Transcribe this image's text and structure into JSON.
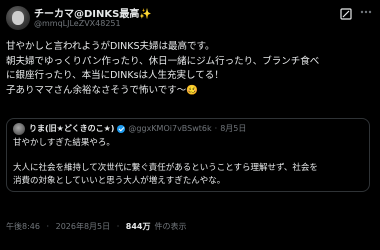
{
  "author": {
    "display_name": "チーカマ@DINKS最高✨",
    "handle": "@mmqLJLeZVX48251"
  },
  "tweet": {
    "lines": [
      "甘やかしと言われようがDINKS夫婦は最高です。",
      "朝夫婦でゆっくりパン作ったり、休日一緒にジム行ったり、ブランチ食べ",
      "に銀座行ったり、本当にDINKsは人生充実してる！",
      "子ありママさん余裕なさそうで怖いです〜🥴"
    ]
  },
  "quoted_tweet": {
    "display_name": "りま(旧★どくきのこ★)",
    "handle": "@ggxKMOi7vBSwt6k",
    "separator": "·",
    "date": "8月5日",
    "lines": [
      "甘やかしすぎた結果やろ。",
      "",
      "大人に社会を維持して次世代に繋ぐ責任があるということすら理解せず、社会を",
      "消費の対象としていいと思う大人が増えすぎたんやな。",
      "..."
    ]
  },
  "meta": {
    "time": "午後8:46",
    "separator": "·",
    "date": "2026年8月5日",
    "separator2": "·",
    "views": "844万",
    "views_label": "件の表示"
  },
  "icons": {
    "grok": "grok-icon",
    "more": "more-icon",
    "verified": "verified-badge-icon"
  },
  "colors": {
    "background": "#000000",
    "text": "#e7e9ea",
    "muted": "#71767b",
    "verified": "#1d9bf0",
    "border": "#2f3336"
  }
}
